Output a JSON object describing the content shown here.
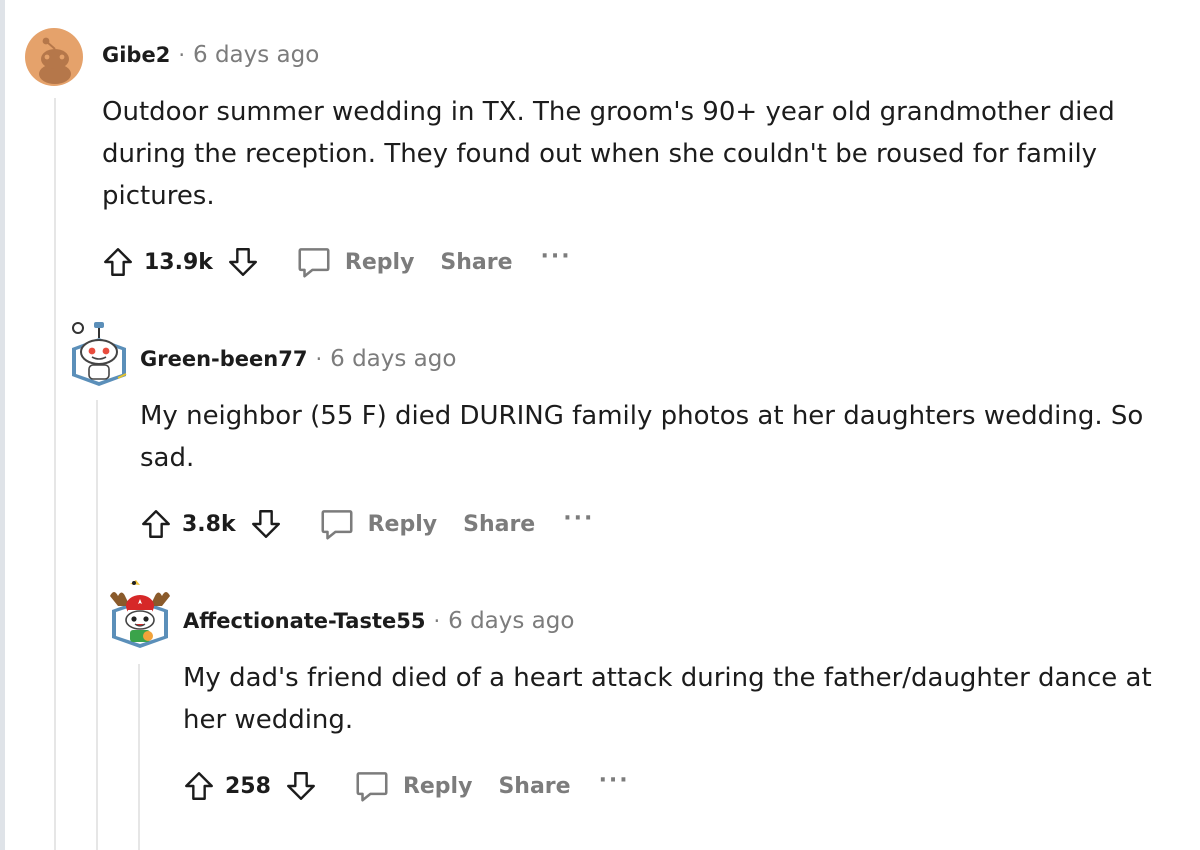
{
  "comments": [
    {
      "author": "Gibe2",
      "separator": "·",
      "time": "6 days ago",
      "body": "Outdoor summer wedding in TX. The groom's 90+ year old grandmother died during the reception. They found out when she couldn't be roused for family pictures.",
      "score": "13.9k",
      "reply_label": "Reply",
      "share_label": "Share",
      "more_label": "···"
    },
    {
      "author": "Green-been77",
      "separator": "·",
      "time": "6 days ago",
      "body": "My neighbor (55 F) died DURING family photos at her daughters wedding. So sad.",
      "score": "3.8k",
      "reply_label": "Reply",
      "share_label": "Share",
      "more_label": "···"
    },
    {
      "author": "Affectionate-Taste55",
      "separator": "·",
      "time": "6 days ago",
      "body": "My dad's friend died of a heart attack during the father/daughter dance at her wedding.",
      "score": "258",
      "reply_label": "Reply",
      "share_label": "Share",
      "more_label": "···"
    }
  ],
  "icons": {
    "upvote": "upvote-arrow-icon",
    "downvote": "downvote-arrow-icon",
    "reply": "speech-bubble-icon"
  },
  "colors": {
    "meta_text": "#7c7c7c",
    "thread_line": "#e6e6e6",
    "default_avatar": "#e5a26b"
  }
}
